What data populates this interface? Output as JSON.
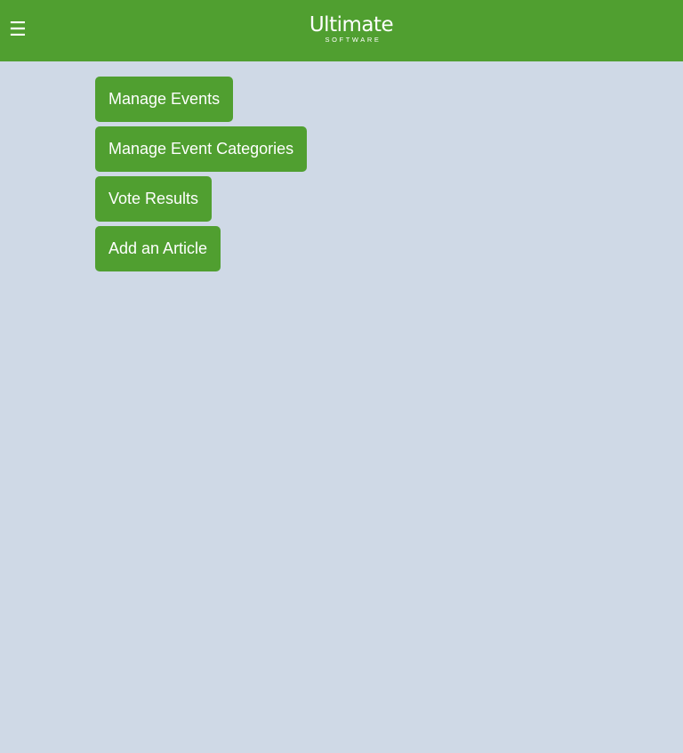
{
  "header": {
    "menu_icon": "hamburger-menu-icon",
    "menu_glyph": "☰",
    "logo_word": "Ultimate",
    "logo_sub": "SOFTWARE",
    "background_color": "#509f30"
  },
  "actions": [
    {
      "label": "Manage Events"
    },
    {
      "label": "Manage Event Categories"
    },
    {
      "label": "Vote Results"
    },
    {
      "label": "Add an Article"
    }
  ],
  "colors": {
    "page_background": "#cfd9e6",
    "button_background": "#509f30",
    "button_text": "#ffffff"
  }
}
